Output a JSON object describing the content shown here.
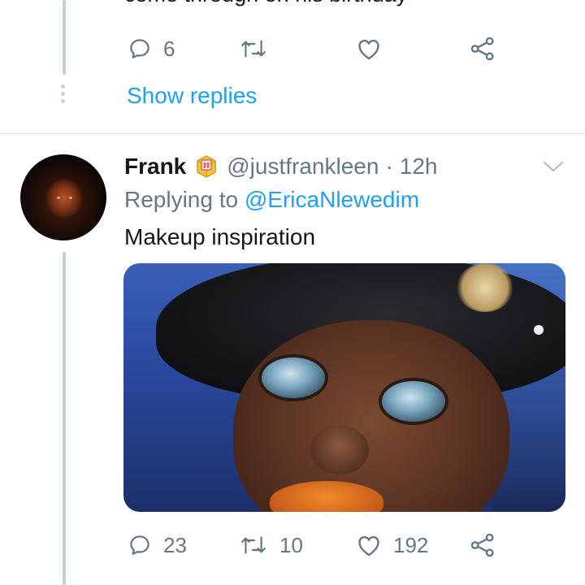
{
  "previous_tweet": {
    "partial_text": "come through on his birthday",
    "reply_count": "6",
    "retweet_count": "",
    "like_count": "",
    "show_replies_label": "Show replies"
  },
  "tweet": {
    "author_name": "Frank",
    "badge_icon": "hashtag-emoji-icon",
    "handle": "@justfrankleen",
    "separator": "·",
    "time": "12h",
    "replying_prefix": "Replying to",
    "replying_mention": "@EricaNlewedim",
    "text": "Makeup inspiration",
    "media_alt": "photo",
    "reply_count": "23",
    "retweet_count": "10",
    "like_count": "192"
  },
  "colors": {
    "accent": "#1da1f2",
    "muted": "#657786",
    "text": "#14171a",
    "thread_line": "#c4cfd6",
    "divider": "#e1e8ed"
  }
}
